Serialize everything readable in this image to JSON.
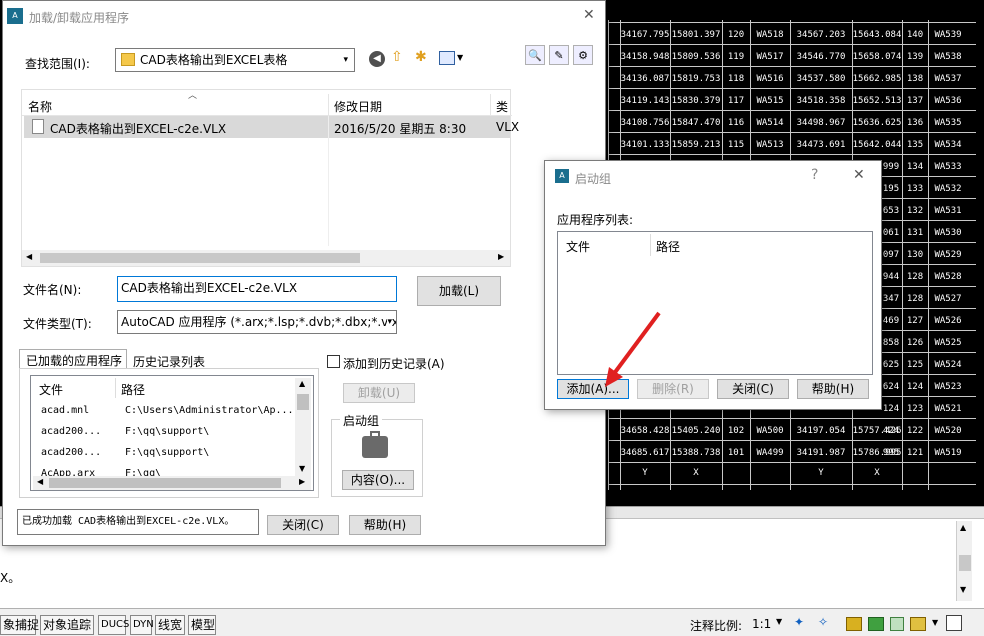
{
  "load_dialog": {
    "title": "加载/卸载应用程序",
    "lookin_label": "查找范围(I):",
    "lookin_value": "CAD表格输出到EXCEL表格",
    "col_name": "名称",
    "col_date": "修改日期",
    "col_type": "类",
    "file": {
      "name": "CAD表格输出到EXCEL-c2e.VLX",
      "date": "2016/5/20 星期五 8:30",
      "type": "VLX"
    },
    "filename_label": "文件名(N):",
    "filename_value": "CAD表格输出到EXCEL-c2e.VLX",
    "filetype_label": "文件类型(T):",
    "filetype_value": "AutoCAD 应用程序 (*.arx;*.lsp;*.dvb;*.dbx;*.vlx",
    "load_button": "加载(L)",
    "tab_loaded": "已加载的应用程序",
    "tab_history": "历史记录列表",
    "add_history": "添加到历史记录(A)",
    "unload_button": "卸载(U)",
    "startup_group": "启动组",
    "contents_button": "内容(O)...",
    "list_col_file": "文件",
    "list_col_path": "路径",
    "loaded_apps": [
      {
        "file": "acad.mnl",
        "path": "C:\\Users\\Administrator\\Ap..."
      },
      {
        "file": "acad200...",
        "path": "F:\\qq\\support\\"
      },
      {
        "file": "acad200...",
        "path": "F:\\qq\\support\\"
      },
      {
        "file": "AcApp.arx",
        "path": "F:\\qq\\"
      }
    ],
    "status_text": "已成功加载 CAD表格输出到EXCEL-c2e.VLX。",
    "close_button": "关闭(C)",
    "help_button": "帮助(H)"
  },
  "startup_dialog": {
    "title": "启动组",
    "list_label": "应用程序列表:",
    "col_file": "文件",
    "col_path": "路径",
    "add_button": "添加(A)...",
    "remove_button": "删除(R)",
    "close_button": "关闭(C)",
    "help_button": "帮助(H)"
  },
  "status_bar": {
    "items": [
      "象捕捉",
      "对象追踪",
      "DUCS",
      "DYN",
      "线宽",
      "模型"
    ],
    "annotation_scale_label": "注释比例:",
    "annotation_scale_value": "1:1"
  },
  "command_line": {
    "text": "X。"
  },
  "grid_rows": [
    [
      "34167.795",
      "15801.397",
      "120",
      "WA518",
      "34567.203",
      "15643.084",
      "140",
      "WA539"
    ],
    [
      "34158.948",
      "15809.536",
      "119",
      "WA517",
      "34546.770",
      "15658.074",
      "139",
      "WA538"
    ],
    [
      "34136.087",
      "15819.753",
      "118",
      "WA516",
      "34537.580",
      "15662.985",
      "138",
      "WA537"
    ],
    [
      "34119.143",
      "15830.379",
      "117",
      "WA515",
      "34518.358",
      "15652.513",
      "137",
      "WA536"
    ],
    [
      "34108.756",
      "15847.470",
      "116",
      "WA514",
      "34498.967",
      "15636.625",
      "136",
      "WA535"
    ],
    [
      "34101.133",
      "15859.213",
      "115",
      "WA513",
      "34473.691",
      "15642.044",
      "135",
      "WA534"
    ]
  ],
  "grid_right_rows": [
    [
      "999",
      "134",
      "WA533"
    ],
    [
      "195",
      "133",
      "WA532"
    ],
    [
      "653",
      "132",
      "WA531"
    ],
    [
      "061",
      "131",
      "WA530"
    ],
    [
      "097",
      "130",
      "WA529"
    ],
    [
      "944",
      "128",
      "WA528"
    ],
    [
      "347",
      "128",
      "WA527"
    ],
    [
      "469",
      "127",
      "WA526"
    ],
    [
      "858",
      "126",
      "WA525"
    ],
    [
      "625",
      "125",
      "WA524"
    ],
    [
      "624",
      "124",
      "WA523"
    ],
    [
      "124",
      "123",
      "WA521"
    ],
    [
      "424",
      "122",
      "WA520"
    ],
    [
      "995",
      "121",
      "WA519"
    ]
  ],
  "grid_bottom_rows": [
    [
      "34658.428",
      "15405.240",
      "102",
      "WA500",
      "34197.054",
      "15757.426"
    ],
    [
      "34685.617",
      "15388.738",
      "101",
      "WA499",
      "34191.987",
      "15786.995"
    ]
  ],
  "grid_header": [
    "Y",
    "X",
    "",
    "",
    "Y",
    "X"
  ]
}
